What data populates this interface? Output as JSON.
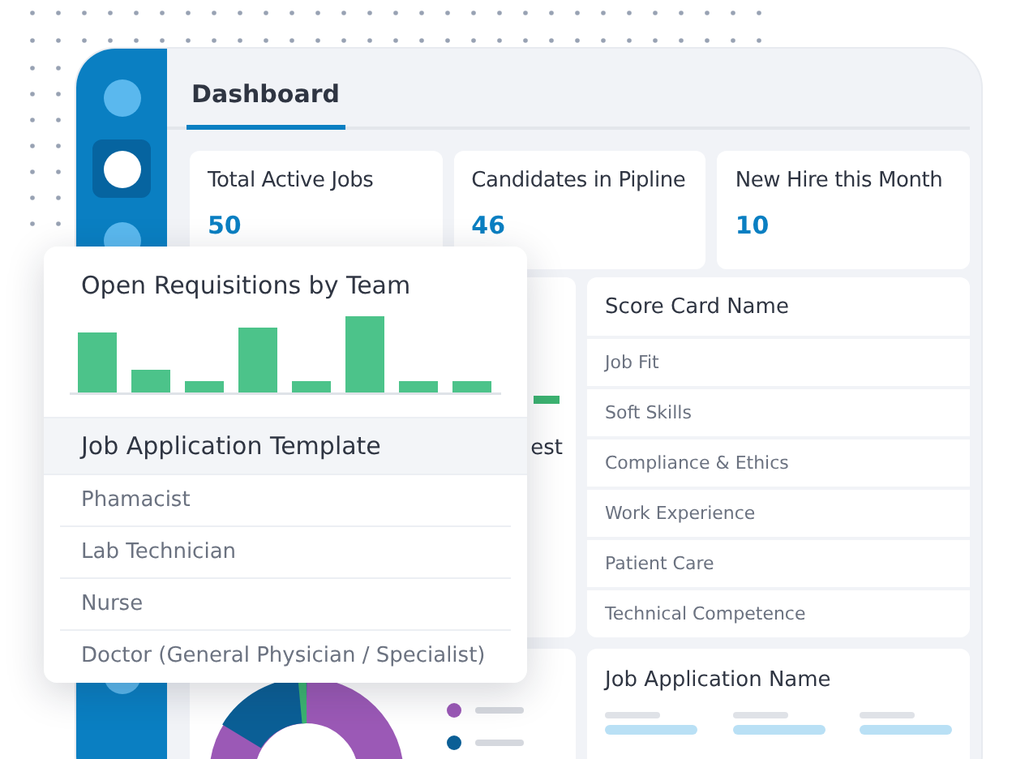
{
  "sidebar": {
    "items": [
      {
        "selected": false
      },
      {
        "selected": true
      },
      {
        "selected": false
      },
      {
        "selected": false
      }
    ]
  },
  "header": {
    "title": "Dashboard"
  },
  "stats": [
    {
      "label": "Total Active Jobs",
      "value": "50"
    },
    {
      "label": "Candidates in Pipline",
      "value": "46"
    },
    {
      "label": "New Hire this Month",
      "value": "10"
    }
  ],
  "hidden_card": {
    "title_fragment": "est"
  },
  "score_card": {
    "title": "Score Card Name",
    "rows": [
      "Job Fit",
      "Soft Skills",
      "Compliance & Ethics",
      "Work Experience",
      "Patient Care",
      "Technical Competence"
    ]
  },
  "job_application_card": {
    "title": "Job Application Name"
  },
  "popup": {
    "title": "Open Requisitions by Team",
    "list_title": "Job Application Template",
    "items": [
      "Phamacist",
      "Lab Technician",
      "Nurse",
      "Doctor (General Physician / Specialist)"
    ]
  }
}
